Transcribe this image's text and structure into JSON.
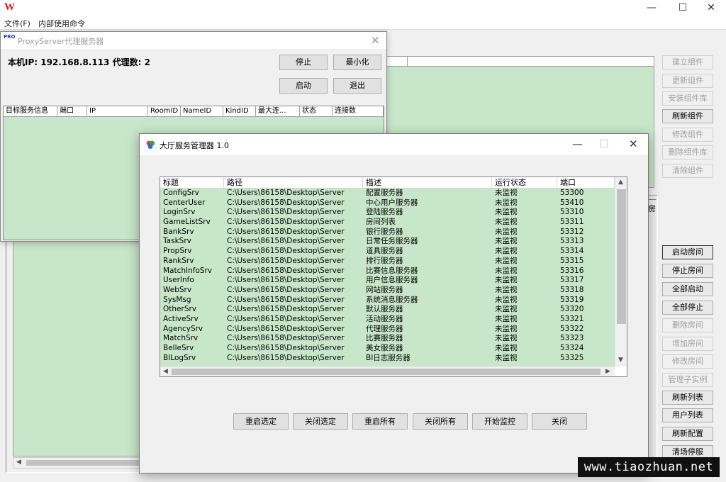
{
  "main_window": {
    "menu": [
      "文件(F)",
      "内部使用命令"
    ],
    "controls": {
      "minimize": "—",
      "maximize": "☐",
      "close": "✕"
    },
    "right_buttons_top": [
      {
        "label": "建立组件",
        "enabled": false
      },
      {
        "label": "更新组件",
        "enabled": false
      },
      {
        "label": "安装组件库",
        "enabled": false
      },
      {
        "label": "刷新组件",
        "enabled": true
      },
      {
        "label": "修改组件",
        "enabled": false
      },
      {
        "label": "删除组件库",
        "enabled": false
      },
      {
        "label": "清除组件",
        "enabled": false
      }
    ],
    "room_header_fragment": "房",
    "right_buttons_bottom": [
      {
        "label": "启动房间",
        "enabled": true
      },
      {
        "label": "停止房间",
        "enabled": true
      },
      {
        "label": "全部启动",
        "enabled": true
      },
      {
        "label": "全部停止",
        "enabled": true
      },
      {
        "label": "删除房间",
        "enabled": false
      },
      {
        "label": "增加房间",
        "enabled": false
      },
      {
        "label": "修改房间",
        "enabled": false
      },
      {
        "label": "管理子实例",
        "enabled": false
      },
      {
        "label": "刷新列表",
        "enabled": true
      },
      {
        "label": "用户列表",
        "enabled": true
      },
      {
        "label": "刷新配置",
        "enabled": true
      },
      {
        "label": "清场停服",
        "enabled": true
      }
    ]
  },
  "proxy_window": {
    "title_icon": "PRO",
    "title": "ProxyServer代理服务器",
    "close": "✕",
    "info": "本机IP: 192.168.8.113  代理数: 2",
    "buttons": {
      "stop": "停止",
      "minimize": "最小化",
      "start": "启动",
      "exit": "退出"
    },
    "columns": [
      "目标服务信息",
      "端口",
      "IP",
      "RoomID",
      "NameID",
      "KindID",
      "最大连...",
      "状态",
      "连接数"
    ]
  },
  "service_manager": {
    "title": "大厅服务管理器 1.0",
    "controls": {
      "minimize": "—",
      "maximize": "☐",
      "close": "✕"
    },
    "columns": {
      "title": "标题",
      "path": "路径",
      "desc": "描述",
      "status": "运行状态",
      "port": "端口"
    },
    "rows": [
      {
        "title": "ConfigSrv",
        "path": "C:\\Users\\86158\\Desktop\\Server",
        "desc": "配置服务器",
        "status": "未监视",
        "port": "53300"
      },
      {
        "title": "CenterUser",
        "path": "C:\\Users\\86158\\Desktop\\Server",
        "desc": "中心用户服务器",
        "status": "未监视",
        "port": "53410"
      },
      {
        "title": "LoginSrv",
        "path": "C:\\Users\\86158\\Desktop\\Server",
        "desc": "登陆服务器",
        "status": "未监视",
        "port": "53310"
      },
      {
        "title": "GameListSrv",
        "path": "C:\\Users\\86158\\Desktop\\Server",
        "desc": "房间列表",
        "status": "未监视",
        "port": "53311"
      },
      {
        "title": "BankSrv",
        "path": "C:\\Users\\86158\\Desktop\\Server",
        "desc": "银行服务器",
        "status": "未监视",
        "port": "53312"
      },
      {
        "title": "TaskSrv",
        "path": "C:\\Users\\86158\\Desktop\\Server",
        "desc": "日常任务服务器",
        "status": "未监视",
        "port": "53313"
      },
      {
        "title": "PropSrv",
        "path": "C:\\Users\\86158\\Desktop\\Server",
        "desc": "道具服务器",
        "status": "未监视",
        "port": "53314"
      },
      {
        "title": "RankSrv",
        "path": "C:\\Users\\86158\\Desktop\\Server",
        "desc": "排行服务器",
        "status": "未监视",
        "port": "53315"
      },
      {
        "title": "MatchInfoSrv",
        "path": "C:\\Users\\86158\\Desktop\\Server",
        "desc": "比赛信息服务器",
        "status": "未监视",
        "port": "53316"
      },
      {
        "title": "UserInfo",
        "path": "C:\\Users\\86158\\Desktop\\Server",
        "desc": "用户信息服务器",
        "status": "未监视",
        "port": "53317"
      },
      {
        "title": "WebSrv",
        "path": "C:\\Users\\86158\\Desktop\\Server",
        "desc": "网站服务器",
        "status": "未监视",
        "port": "53318"
      },
      {
        "title": "SysMsg",
        "path": "C:\\Users\\86158\\Desktop\\Server",
        "desc": "系统消息服务器",
        "status": "未监视",
        "port": "53319"
      },
      {
        "title": "OtherSrv",
        "path": "C:\\Users\\86158\\Desktop\\Server",
        "desc": "默认服务器",
        "status": "未监视",
        "port": "53320"
      },
      {
        "title": "ActiveSrv",
        "path": "C:\\Users\\86158\\Desktop\\Server",
        "desc": "活动服务器",
        "status": "未监视",
        "port": "53321"
      },
      {
        "title": "AgencySrv",
        "path": "C:\\Users\\86158\\Desktop\\Server",
        "desc": "代理服务器",
        "status": "未监视",
        "port": "53322"
      },
      {
        "title": "MatchSrv",
        "path": "C:\\Users\\86158\\Desktop\\Server",
        "desc": "比赛服务器",
        "status": "未监视",
        "port": "53323"
      },
      {
        "title": "BelleSrv",
        "path": "C:\\Users\\86158\\Desktop\\Server",
        "desc": "美女服务器",
        "status": "未监视",
        "port": "53324"
      },
      {
        "title": "BILogSrv",
        "path": "C:\\Users\\86158\\Desktop\\Server",
        "desc": "BI日志服务器",
        "status": "未监视",
        "port": "53325"
      }
    ],
    "buttons": [
      "重启选定",
      "关闭选定",
      "重启所有",
      "关闭所有",
      "开始监控",
      "关闭"
    ]
  },
  "watermark": "www.tiaozhuan.net",
  "colors": {
    "list_bg": "#c8e6c9",
    "logo_red": "#d81e1e"
  }
}
